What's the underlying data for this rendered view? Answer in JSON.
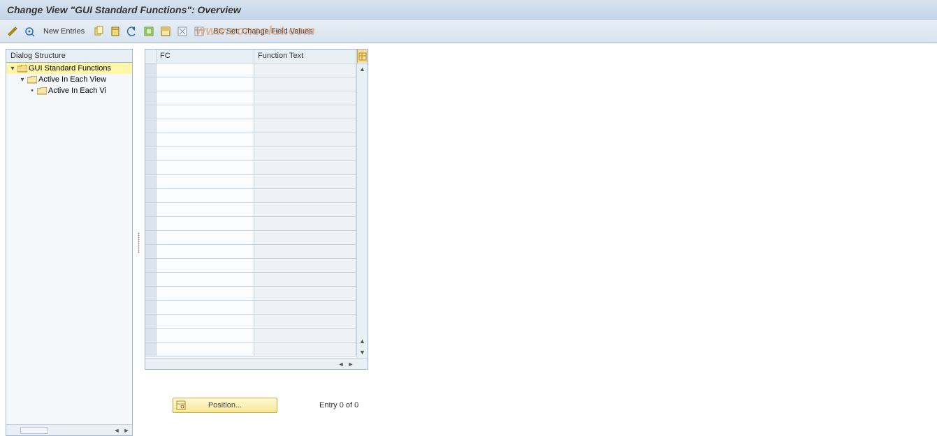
{
  "title": "Change View \"GUI Standard Functions\": Overview",
  "toolbar": {
    "new_entries_label": "New Entries",
    "bc_set_label": "BC Set: Change Field Values"
  },
  "watermark": "www.consolut.com",
  "tree": {
    "header": "Dialog Structure",
    "nodes": [
      {
        "label": "GUI Standard Functions",
        "level": 0,
        "selected": true,
        "expanded": true,
        "icon": "folder-open"
      },
      {
        "label": "Active In Each View",
        "level": 1,
        "selected": false,
        "expanded": true,
        "icon": "folder"
      },
      {
        "label": "Active In Each Vi",
        "level": 2,
        "selected": false,
        "expanded": false,
        "icon": "folder"
      }
    ]
  },
  "table": {
    "columns": {
      "fc": "FC",
      "function_text": "Function Text"
    },
    "row_count": 21
  },
  "footer": {
    "position_label": "Position...",
    "entry_label": "Entry 0 of 0"
  }
}
